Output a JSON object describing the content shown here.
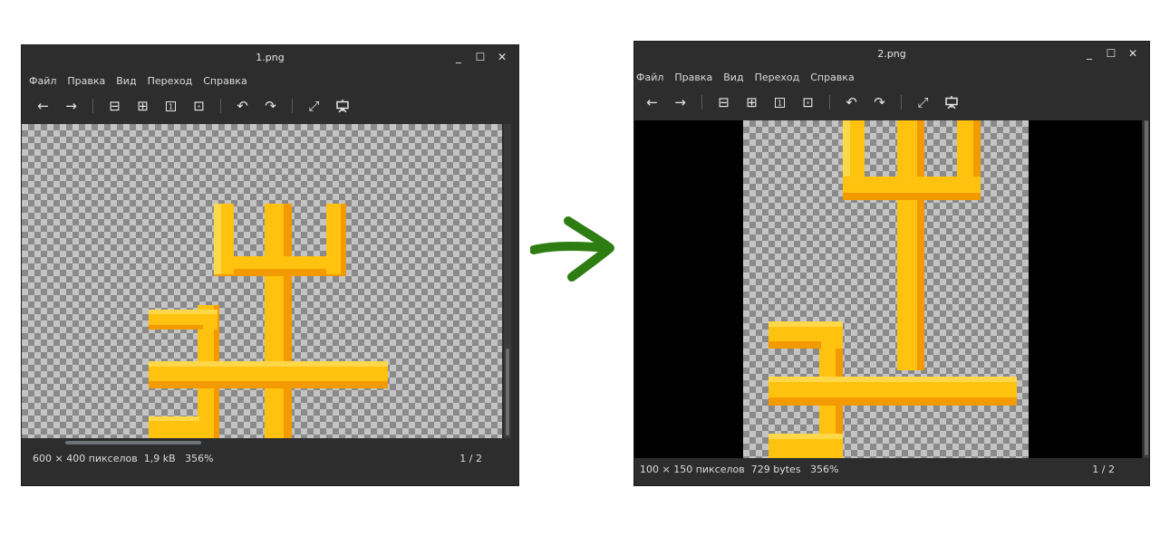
{
  "windows": [
    {
      "title": "1.png",
      "controls": {
        "minimize": "_",
        "maximize": "☐",
        "close": "✕"
      },
      "menu": [
        "Файл",
        "Правка",
        "Вид",
        "Переход",
        "Справка"
      ],
      "status": {
        "dimensions": "600 × 400 пикселов",
        "size": "1,9 kB",
        "zoom": "356%",
        "page": "1 / 2"
      }
    },
    {
      "title": "2.png",
      "controls": {
        "minimize": "_",
        "maximize": "☐",
        "close": "✕"
      },
      "menu": [
        "Файл",
        "Правка",
        "Вид",
        "Переход",
        "Справка"
      ],
      "status": {
        "dimensions": "100 × 150 пикселов",
        "size": "729 bytes",
        "zoom": "356%",
        "page": "1 / 2"
      }
    }
  ],
  "toolbar_icons": {
    "back": "←",
    "forward": "→",
    "zoom_out": "⊟",
    "zoom_in": "⊞",
    "zoom_normal": "1",
    "zoom_fit": "⊡",
    "rotate_left": "↶",
    "rotate_right": "↷",
    "fullscreen": "⤢",
    "slideshow": "slideshow-icon"
  },
  "colors": {
    "window_bg": "#2d2d2d",
    "gold": "#ffc20e",
    "gold_dark": "#f29a00",
    "gold_light": "#ffd84a",
    "arrow_green": "#2e7d12"
  }
}
